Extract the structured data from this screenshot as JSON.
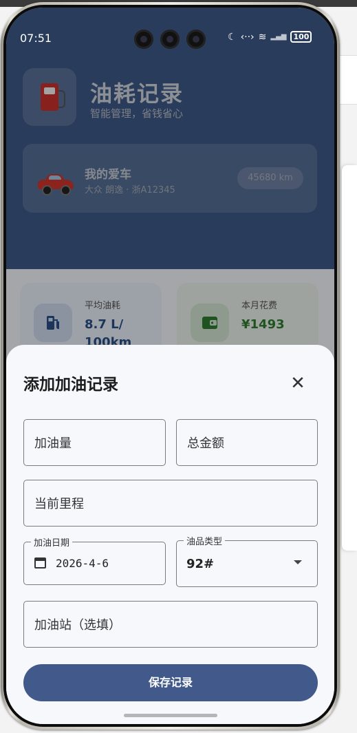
{
  "status_bar": {
    "time": "07:51",
    "battery": "100"
  },
  "header": {
    "title": "油耗记录",
    "subtitle": "智能管理，省钱省心"
  },
  "car": {
    "name": "我的爱车",
    "model": "大众 朗逸 · 浙A12345",
    "mileage": "45680 km"
  },
  "stats": [
    {
      "label": "平均油耗",
      "value": "8.7 L/ 100km",
      "icon": "fuel-pump-icon"
    },
    {
      "label": "本月花费",
      "value": "¥1493",
      "icon": "wallet-icon"
    }
  ],
  "sheet": {
    "title": "添加加油记录",
    "fuel_amount_placeholder": "加油量",
    "total_price_placeholder": "总金额",
    "mileage_placeholder": "当前里程",
    "date_label": "加油日期",
    "date_value": "2026-4-6",
    "fuel_type_label": "油品类型",
    "fuel_type_value": "92#",
    "station_placeholder": "加油站（选填）",
    "save_label": "保存记录"
  },
  "colors": {
    "primary": "#41598b",
    "green": "#2e7d32",
    "blue": "#2a4f86"
  }
}
